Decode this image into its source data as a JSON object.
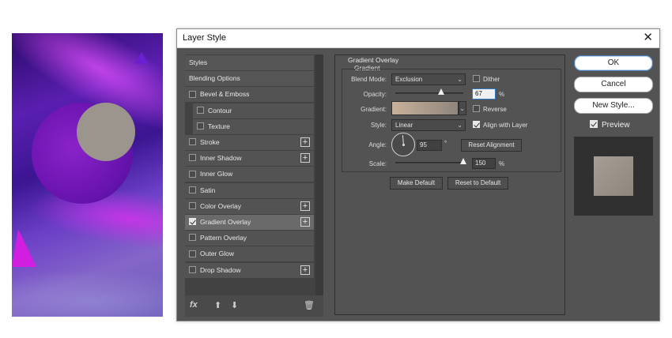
{
  "artwork": {
    "description_icon": "purple-abstract-artwork",
    "colors": {
      "circle_large": "#7a1cc0",
      "circle_small": "#9b958e",
      "triangle": "#d21ee0"
    }
  },
  "dialog": {
    "title": "Layer Style",
    "close_label": "✕",
    "styles_list": [
      {
        "label": "Styles",
        "checkbox": false,
        "checked": false,
        "plus": false,
        "indent": false,
        "active": false
      },
      {
        "label": "Blending Options",
        "checkbox": false,
        "checked": false,
        "plus": false,
        "indent": false,
        "active": false
      },
      {
        "label": "Bevel & Emboss",
        "checkbox": true,
        "checked": false,
        "plus": false,
        "indent": false,
        "active": false
      },
      {
        "label": "Contour",
        "checkbox": true,
        "checked": false,
        "plus": false,
        "indent": true,
        "active": false
      },
      {
        "label": "Texture",
        "checkbox": true,
        "checked": false,
        "plus": false,
        "indent": true,
        "active": false
      },
      {
        "label": "Stroke",
        "checkbox": true,
        "checked": false,
        "plus": true,
        "indent": false,
        "active": false
      },
      {
        "label": "Inner Shadow",
        "checkbox": true,
        "checked": false,
        "plus": true,
        "indent": false,
        "active": false
      },
      {
        "label": "Inner Glow",
        "checkbox": true,
        "checked": false,
        "plus": false,
        "indent": false,
        "active": false
      },
      {
        "label": "Satin",
        "checkbox": true,
        "checked": false,
        "plus": false,
        "indent": false,
        "active": false
      },
      {
        "label": "Color Overlay",
        "checkbox": true,
        "checked": false,
        "plus": true,
        "indent": false,
        "active": false
      },
      {
        "label": "Gradient Overlay",
        "checkbox": true,
        "checked": true,
        "plus": true,
        "indent": false,
        "active": true
      },
      {
        "label": "Pattern Overlay",
        "checkbox": true,
        "checked": false,
        "plus": false,
        "indent": false,
        "active": false
      },
      {
        "label": "Outer Glow",
        "checkbox": true,
        "checked": false,
        "plus": false,
        "indent": false,
        "active": false
      },
      {
        "label": "Drop Shadow",
        "checkbox": true,
        "checked": false,
        "plus": true,
        "indent": false,
        "active": false
      }
    ],
    "footer": {
      "fx_label": "fx",
      "up_icon": "arrow-up-icon",
      "down_icon": "arrow-down-icon",
      "trash_icon": "trash-icon"
    },
    "gradient_overlay": {
      "group_title": "Gradient Overlay",
      "sub_title": "Gradient",
      "blend_mode_label": "Blend Mode:",
      "blend_mode_value": "Exclusion",
      "dither_label": "Dither",
      "dither_checked": false,
      "opacity_label": "Opacity:",
      "opacity_value": "67",
      "opacity_fraction": 0.67,
      "opacity_unit": "%",
      "gradient_label": "Gradient:",
      "gradient_colors": [
        "#c8b19a",
        "#8f857c"
      ],
      "reverse_label": "Reverse",
      "reverse_checked": false,
      "style_label": "Style:",
      "style_value": "Linear",
      "align_label": "Align with Layer",
      "align_checked": true,
      "angle_label": "Angle:",
      "angle_value": "95",
      "angle_unit": "°",
      "reset_alignment_label": "Reset Alignment",
      "scale_label": "Scale:",
      "scale_value": "150",
      "scale_fraction": 1.0,
      "scale_unit": "%",
      "make_default_label": "Make Default",
      "reset_default_label": "Reset to Default"
    },
    "buttons": {
      "ok": "OK",
      "cancel": "Cancel",
      "new_style": "New Style...",
      "preview_label": "Preview",
      "preview_checked": true
    }
  }
}
